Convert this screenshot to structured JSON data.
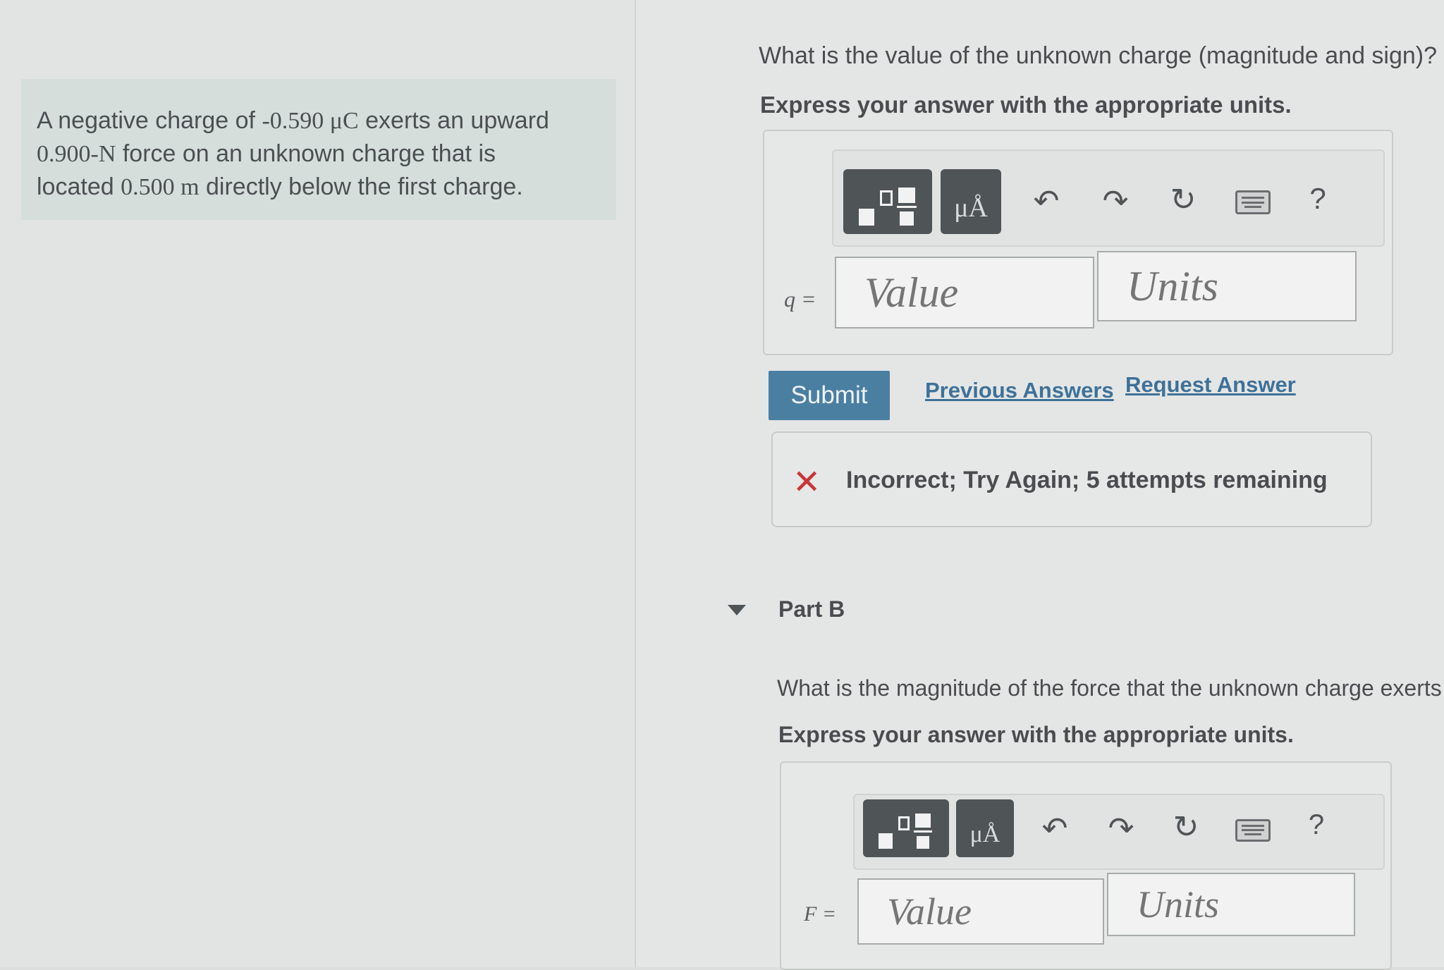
{
  "problem": {
    "prefix": "A negative charge of ",
    "charge": "-0.590 μC",
    "mid1": " exerts an upward",
    "force": "0.900-N",
    "mid2": " force on an unknown charge that is",
    "line3_start": "located ",
    "distance": "0.500 m",
    "line3_end": " directly below the first charge."
  },
  "partA": {
    "question": "What is the value of the unknown charge (magnitude and sign)?",
    "instruction": "Express your answer with the appropriate units.",
    "variable": "q =",
    "value_placeholder": "Value",
    "units_placeholder": "Units",
    "toolbar": {
      "templates_icon": "fraction-template-icon",
      "units_button": "μÅ",
      "undo_icon": "undo-icon",
      "redo_icon": "redo-icon",
      "reset_icon": "reset-icon",
      "keyboard_icon": "keyboard-icon",
      "help": "?"
    },
    "submit_label": "Submit",
    "previous_answers": "Previous Answers",
    "request_answer": "Request Answer",
    "feedback_text": "Incorrect; Try Again; 5 attempts remaining",
    "feedback_icon": "✕"
  },
  "partB": {
    "title": "Part B",
    "question": "What is the magnitude of the force that the unknown charge exerts",
    "instruction": "Express your answer with the appropriate units.",
    "variable": "F =",
    "value_placeholder": "Value",
    "units_placeholder": "Units",
    "toolbar": {
      "templates_icon": "fraction-template-icon",
      "units_button": "μÅ",
      "undo_icon": "undo-icon",
      "redo_icon": "redo-icon",
      "reset_icon": "reset-icon",
      "keyboard_icon": "keyboard-icon",
      "help": "?"
    }
  },
  "colors": {
    "submit": "#4a7fa2",
    "link": "#3e7199",
    "error": "#c8363a",
    "toolbar_button": "#4f5457"
  }
}
